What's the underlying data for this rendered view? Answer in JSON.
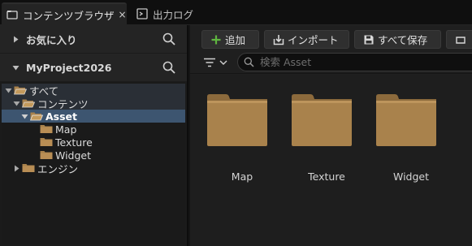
{
  "tabs": [
    {
      "label": "コンテンツブラウザ",
      "close": "×",
      "icon": "content-browser-icon"
    },
    {
      "label": "出力ログ",
      "icon": "output-log-icon"
    }
  ],
  "sections": {
    "favorites": {
      "label": "お気に入り",
      "expanded": false
    },
    "project": {
      "label": "MyProject2026",
      "expanded": true
    }
  },
  "tree": [
    {
      "label": "すべて",
      "expanded": true,
      "depth": 0
    },
    {
      "label": "コンテンツ",
      "expanded": true,
      "depth": 1
    },
    {
      "label": "Asset",
      "expanded": true,
      "depth": 2,
      "selected": true
    },
    {
      "label": "Map",
      "depth": 3
    },
    {
      "label": "Texture",
      "depth": 3
    },
    {
      "label": "Widget",
      "depth": 3
    },
    {
      "label": "エンジン",
      "expanded": false,
      "depth": 1
    }
  ],
  "toolbar": {
    "add_label": "追加",
    "import_label": "インポート",
    "save_all_label": "すべて保存"
  },
  "search": {
    "placeholder": "検索 Asset",
    "value": ""
  },
  "assets": [
    {
      "label": "Map",
      "type": "folder"
    },
    {
      "label": "Texture",
      "type": "folder"
    },
    {
      "label": "Widget",
      "type": "folder"
    }
  ],
  "colors": {
    "selection": "#3d5570",
    "folder": "#a9824c",
    "add_icon": "#5fb640"
  }
}
